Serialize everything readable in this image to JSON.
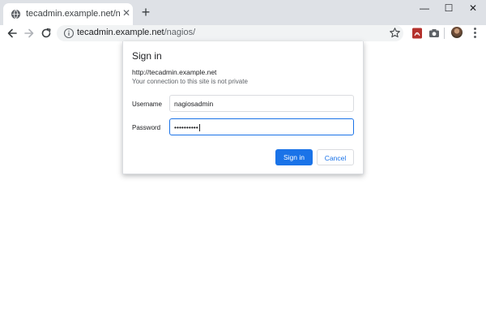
{
  "browser": {
    "tab": {
      "title": "tecadmin.example.net/nagios/",
      "close_glyph": "✕"
    },
    "new_tab_glyph": "+",
    "window_controls": {
      "minimize": "—",
      "maximize": "☐",
      "close": "✕"
    },
    "omnibox": {
      "host": "tecadmin.example.net",
      "path": "/nagios/"
    }
  },
  "dialog": {
    "title": "Sign in",
    "site": "http://tecadmin.example.net",
    "warning": "Your connection to this site is not private",
    "username_label": "Username",
    "username_value": "nagiosadmin",
    "password_label": "Password",
    "password_value": "••••••••••",
    "sign_in_label": "Sign in",
    "cancel_label": "Cancel"
  },
  "colors": {
    "accent": "#1a73e8",
    "tabstrip": "#dee1e6",
    "omnibox_bg": "#f1f3f4"
  },
  "icons": [
    "globe-icon",
    "back-icon",
    "forward-icon",
    "reload-icon",
    "info-icon",
    "star-icon",
    "pdf-extension-icon",
    "camera-extension-icon",
    "avatar",
    "menu-icon"
  ]
}
